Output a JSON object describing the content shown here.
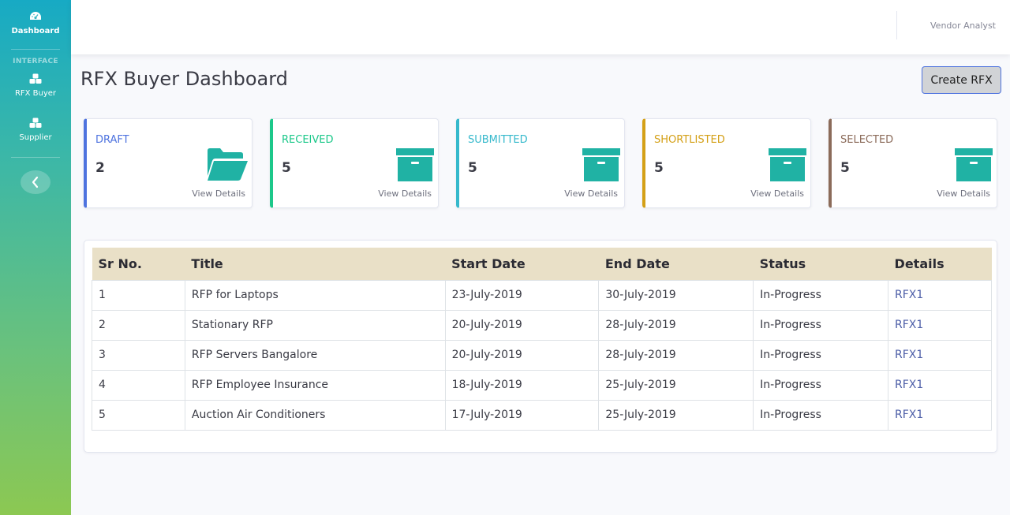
{
  "sidebar": {
    "items": [
      {
        "label": "Dashboard",
        "icon": "dashboard-icon"
      },
      {
        "label": "RFX Buyer",
        "icon": "cubes-icon"
      },
      {
        "label": "Supplier",
        "icon": "cubes-icon"
      }
    ],
    "heading": "INTERFACE",
    "toggle_icon": "chevron-left-icon",
    "gradient": [
      "#17aac4",
      "#8cc852"
    ]
  },
  "topbar": {
    "user_name": "Vendor Analyst"
  },
  "page": {
    "title": "RFX Buyer Dashboard",
    "create_button": "Create RFX"
  },
  "cards": [
    {
      "label": "DRAFT",
      "count": "2",
      "link": "View Details",
      "color": "#4e73df",
      "icon": "folder-open-icon"
    },
    {
      "label": "RECEIVED",
      "count": "5",
      "link": "View Details",
      "color": "#1cc88a",
      "icon": "archive-icon"
    },
    {
      "label": "SUBMITTED",
      "count": "5",
      "link": "View Details",
      "color": "#36b9cc",
      "icon": "archive-icon"
    },
    {
      "label": "SHORTLISTED",
      "count": "5",
      "link": "View Details",
      "color": "#d4a017",
      "icon": "archive-icon"
    },
    {
      "label": "SELECTED",
      "count": "5",
      "link": "View Details",
      "color": "#8b6b5a",
      "icon": "archive-icon"
    }
  ],
  "icon_color": "#20b2a4",
  "table": {
    "headers": [
      "Sr No.",
      "Title",
      "Start Date",
      "End Date",
      "Status",
      "Details"
    ],
    "rows": [
      [
        "1",
        "RFP for Laptops",
        "23-July-2019",
        "30-July-2019",
        "In-Progress",
        "RFX1"
      ],
      [
        "2",
        "Stationary RFP",
        "20-July-2019",
        "28-July-2019",
        "In-Progress",
        "RFX1"
      ],
      [
        "3",
        "RFP Servers Bangalore",
        "20-July-2019",
        "28-July-2019",
        "In-Progress",
        "RFX1"
      ],
      [
        "4",
        "RFP Employee Insurance",
        "18-July-2019",
        "25-July-2019",
        "In-Progress",
        "RFX1"
      ],
      [
        "5",
        "Auction Air Conditioners",
        "17-July-2019",
        "25-July-2019",
        "In-Progress",
        "RFX1"
      ]
    ]
  }
}
